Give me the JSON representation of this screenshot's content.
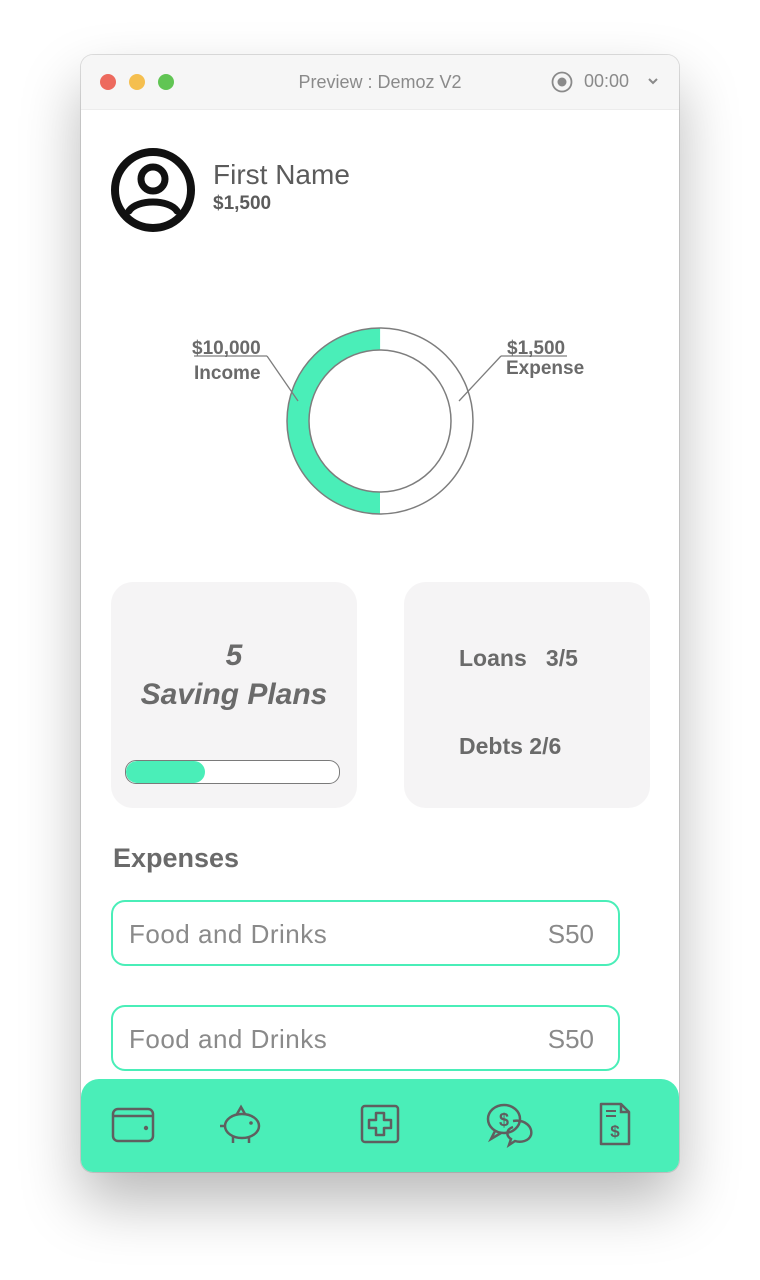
{
  "window": {
    "title": "Preview : Demoz V2",
    "timer": "00:00"
  },
  "profile": {
    "name": "First Name",
    "balance": "$1,500"
  },
  "overview": {
    "income_amount": "$10,000",
    "income_label": "Income",
    "expense_amount": "$1,500",
    "expense_label": "Expense",
    "income_fraction": 0.5
  },
  "savings": {
    "count": "5",
    "label": "Saving Plans",
    "progress": 0.37
  },
  "obligations": {
    "loans": "Loans   3/5",
    "debts": "Debts 2/6"
  },
  "expenses": {
    "title": "Expenses",
    "items": [
      {
        "name": "Food and Drinks",
        "amount": "S50"
      },
      {
        "name": "Food and Drinks",
        "amount": "S50"
      }
    ]
  },
  "nav": {
    "icons": [
      "wallet-icon",
      "piggy-bank-icon",
      "add-icon",
      "money-chat-icon",
      "invoice-icon"
    ]
  },
  "colors": {
    "accent": "#4aeeb8",
    "card": "#f5f4f5",
    "text": "#6a6a6a"
  }
}
